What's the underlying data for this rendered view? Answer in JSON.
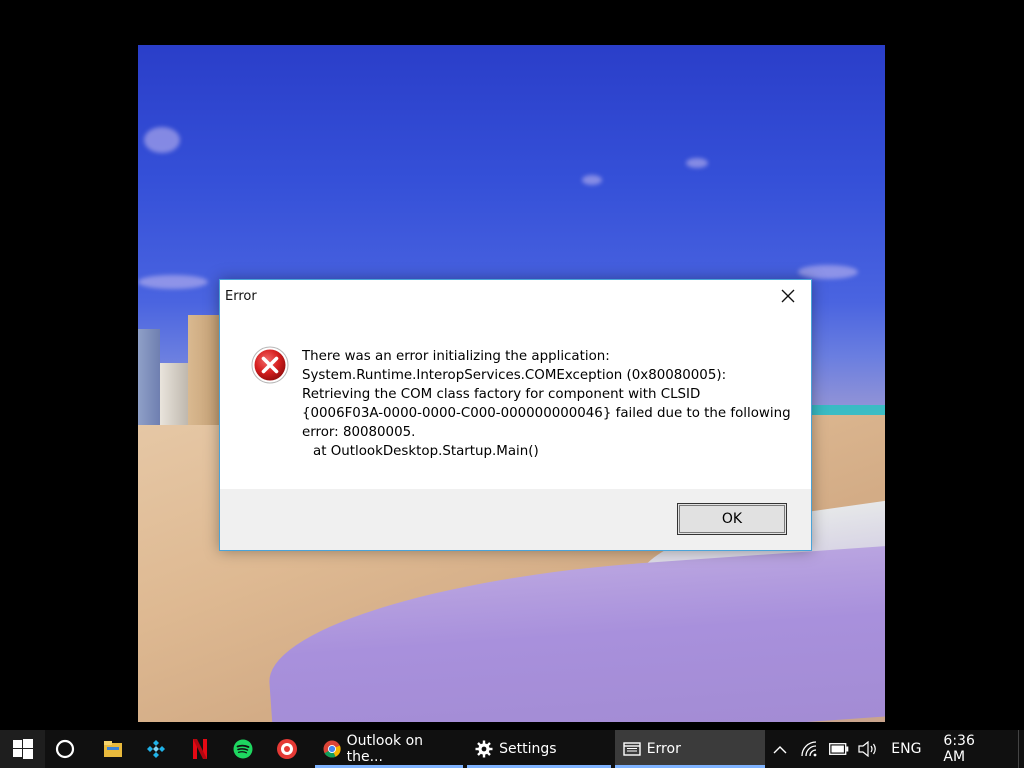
{
  "dialog": {
    "title": "Error",
    "message_lines": [
      "There was an error initializing the application:",
      "System.Runtime.InteropServices.COMException (0x80080005):",
      "Retrieving the COM class factory for component with CLSID",
      "{0006F03A-0000-0000-C000-000000000046} failed due to the following",
      "error: 80080005.",
      "at OutlookDesktop.Startup.Main()"
    ],
    "ok_label": "OK",
    "icon": "error-icon",
    "close_icon": "close-icon"
  },
  "taskbar": {
    "start_icon": "windows-start-icon",
    "search_icon": "cortana-icon",
    "pinned": [
      {
        "name": "file-explorer-icon"
      },
      {
        "name": "kodi-icon"
      },
      {
        "name": "netflix-icon"
      },
      {
        "name": "spotify-icon"
      },
      {
        "name": "fol-icon"
      }
    ],
    "apps": [
      {
        "label": "Outlook on the...",
        "icon": "chrome-icon"
      },
      {
        "label": "Settings",
        "icon": "gear-icon"
      },
      {
        "label": "Error",
        "icon": "window-icon"
      }
    ],
    "tray": {
      "chevron_icon": "chevron-up-icon",
      "network_icon": "wifi-icon",
      "battery_icon": "battery-icon",
      "volume_icon": "volume-icon",
      "language": "ENG",
      "time": "6:36 AM"
    }
  },
  "colors": {
    "dialog_border": "#4aa3d8",
    "taskbar_bg": "#101010",
    "active_underline": "#7fb3ff"
  }
}
